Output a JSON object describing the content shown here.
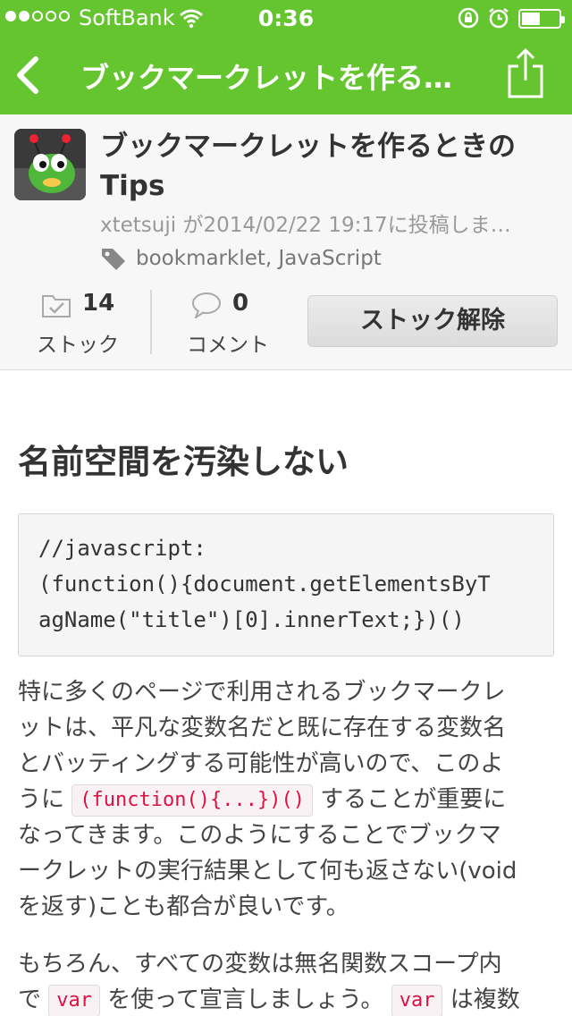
{
  "status_bar": {
    "carrier": "SoftBank",
    "time": "0:36",
    "signal_filled": 2,
    "signal_total": 5,
    "battery_level": 0.5
  },
  "nav": {
    "title": "ブックマークレットを作る…",
    "back_icon": "chevron-left-icon",
    "share_icon": "share-icon"
  },
  "post": {
    "title_line1": "ブックマークレットを作るときの",
    "title_line2": "Tips",
    "byline": "xtetsuji が2014/02/22 19:17に投稿しま…",
    "tags": "bookmarklet, JavaScript",
    "stock_count": "14",
    "stock_label": "ストック",
    "comment_count": "0",
    "comment_label": "コメント",
    "unstock_button": "ストック解除"
  },
  "content": {
    "heading": "名前空間を汚染しない",
    "code_lines": [
      "//javascript:",
      "(function(){document.getElementsByT",
      "agName(\"title\")[0].innerText;})()"
    ],
    "p1": {
      "l1": "特に多くのページで利用されるブックマークレ",
      "l2": "ットは、平凡な変数名だと既に存在する変数名",
      "l3": "とバッティングする可能性が高いので、このよ",
      "l4_before": "うに",
      "l4_code": "(function(){...})()",
      "l4_after": "することが重要に",
      "l5": "なってきます。このようにすることでブックマ",
      "l6": "ークレットの実行結果として何も返さない(void",
      "l7": "を返す)ことも都合が良いです。"
    },
    "p2": {
      "l1": "もちろん、すべての変数は無名関数スコープ内",
      "l2_before": "で",
      "l2_code": "var",
      "l2_mid": "を使って宣言しましょう。",
      "l2_code2": "var",
      "l2_after": "は複数"
    }
  },
  "colors": {
    "accent_green": "#65c52e",
    "code_red": "#dd1144"
  }
}
